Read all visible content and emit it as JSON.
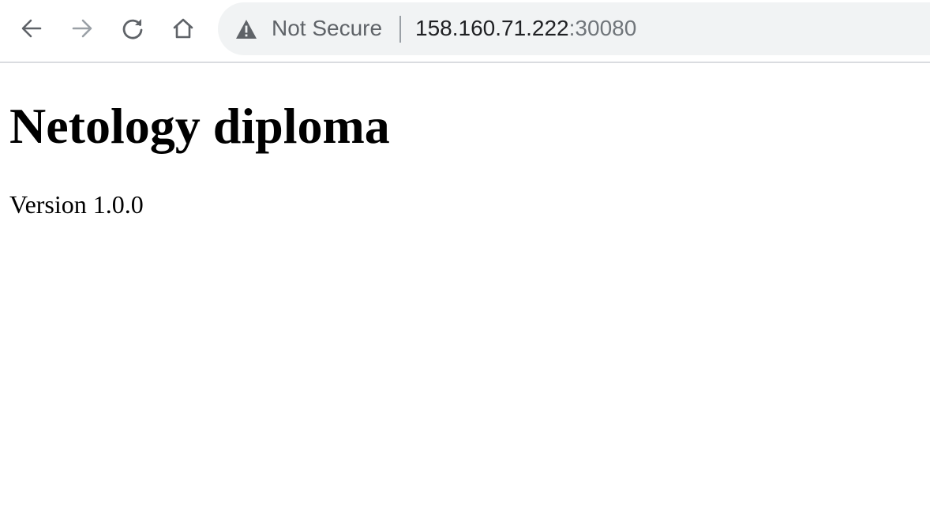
{
  "browser": {
    "nav": {
      "back_icon": "arrow-left-icon",
      "forward_icon": "arrow-right-icon",
      "reload_icon": "reload-icon",
      "home_icon": "home-icon"
    },
    "address_bar": {
      "security_icon": "warning-triangle-icon",
      "security_label": "Not Secure",
      "host": "158.160.71.222",
      "port": ":30080"
    },
    "colors": {
      "omnibox_bg": "#f1f3f4",
      "icon_active": "#5f6368",
      "icon_disabled": "#9aa0a6"
    }
  },
  "page": {
    "title": "Netology diploma",
    "version": "Version 1.0.0"
  }
}
